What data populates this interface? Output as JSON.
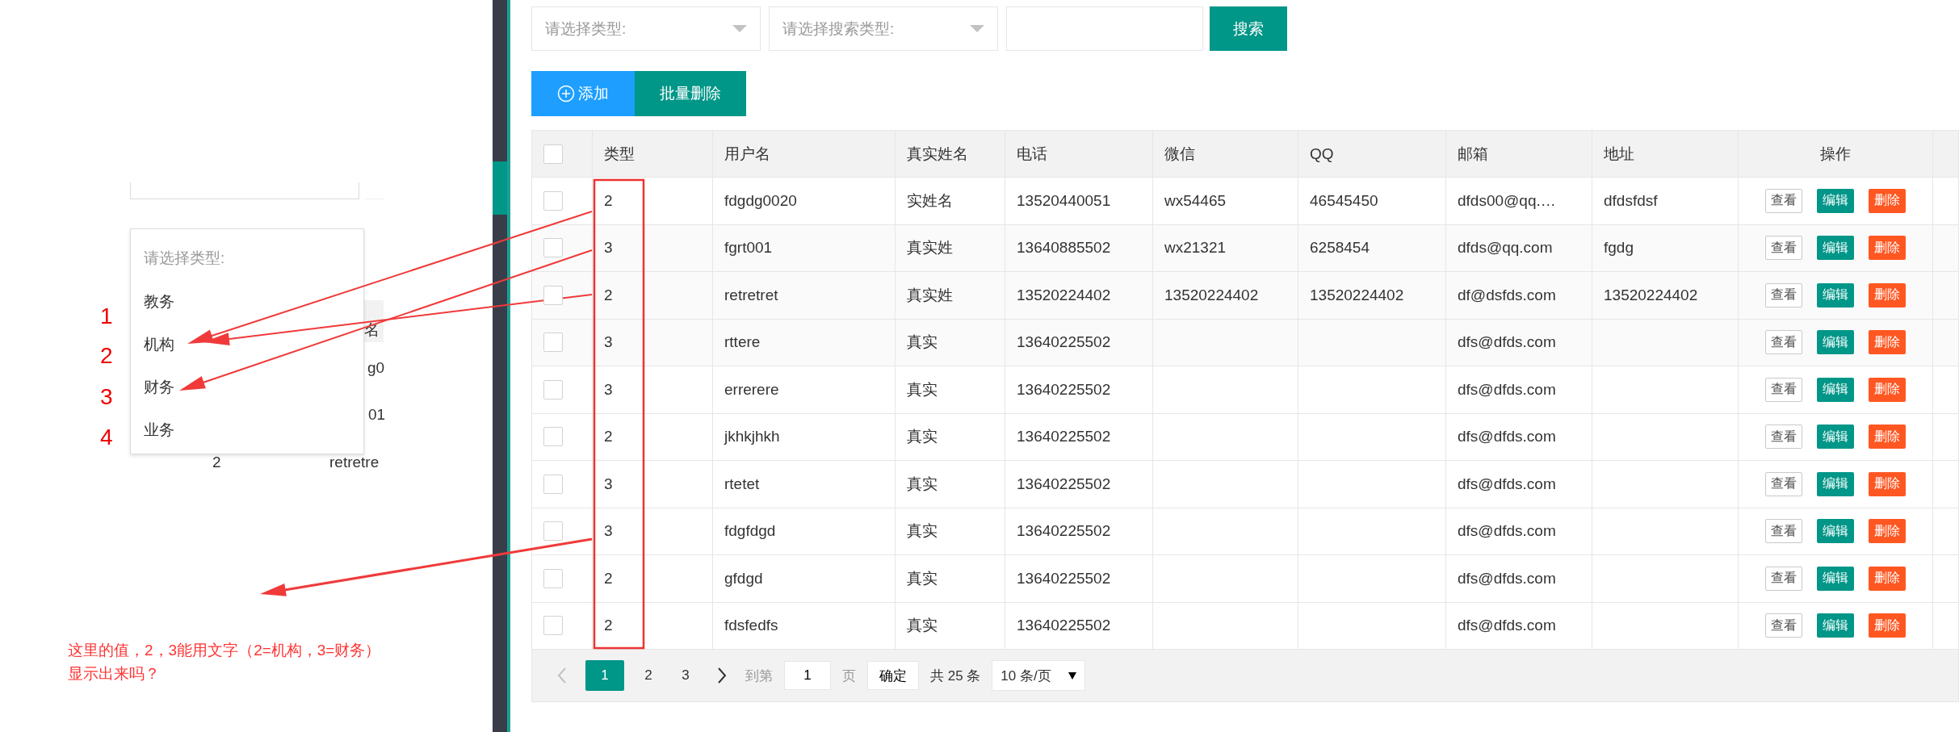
{
  "left_panel": {
    "table_fragment": {
      "texts": [
        "名",
        "g0",
        "01",
        "2",
        "retretre"
      ]
    },
    "dropdown": {
      "placeholder": "请选择类型:",
      "options": [
        {
          "label": "教务"
        },
        {
          "label": "机构"
        },
        {
          "label": "财务"
        },
        {
          "label": "业务"
        }
      ]
    }
  },
  "annotations": {
    "numbers": [
      "1",
      "2",
      "3",
      "4"
    ],
    "note": "这里的值，2，3能用文字（2=机构，3=财务）显示出来吗？"
  },
  "toolbar": {
    "type_select": {
      "placeholder": "请选择类型:"
    },
    "search_type_select": {
      "placeholder": "请选择搜索类型:"
    },
    "search_button": "搜索"
  },
  "actions": {
    "add_button": "添加",
    "batch_delete_button": "批量删除"
  },
  "table": {
    "header_checkbox": {
      "checked": false
    },
    "columns": [
      "类型",
      "用户名",
      "真实姓名",
      "电话",
      "微信",
      "QQ",
      "邮箱",
      "地址",
      "操作"
    ],
    "rows": [
      {
        "checked": false,
        "type": "2",
        "username": "fdgdg0020",
        "real_name": "实姓名",
        "phone": "13520440051",
        "wechat": "wx54465",
        "qq": "46545450",
        "email": "dfds00@qq.…",
        "address": "dfdsfdsf",
        "actions": [
          {
            "kind": "view",
            "label": "查看"
          },
          {
            "kind": "edit",
            "label": "编辑"
          },
          {
            "kind": "delete",
            "label": "删除"
          }
        ]
      },
      {
        "checked": false,
        "type": "3",
        "username": "fgrt001",
        "real_name": "真实姓",
        "phone": "13640885502",
        "wechat": "wx21321",
        "qq": "6258454",
        "email": "dfds@qq.com",
        "address": "fgdg",
        "actions": [
          {
            "kind": "view",
            "label": "查看"
          },
          {
            "kind": "edit",
            "label": "编辑"
          },
          {
            "kind": "delete",
            "label": "删除"
          }
        ]
      },
      {
        "checked": false,
        "type": "2",
        "username": "retretret",
        "real_name": "真实姓",
        "phone": "13520224402",
        "wechat": "13520224402",
        "qq": "13520224402",
        "email": "df@dsfds.com",
        "address": "13520224402",
        "actions": [
          {
            "kind": "view",
            "label": "查看"
          },
          {
            "kind": "edit",
            "label": "编辑"
          },
          {
            "kind": "delete",
            "label": "删除"
          }
        ]
      },
      {
        "checked": false,
        "type": "3",
        "username": "rttere",
        "real_name": "真实",
        "phone": "13640225502",
        "email": "dfs@dfds.com",
        "actions": [
          {
            "kind": "view",
            "label": "查看"
          },
          {
            "kind": "edit",
            "label": "编辑"
          },
          {
            "kind": "delete",
            "label": "删除"
          }
        ]
      },
      {
        "checked": false,
        "type": "3",
        "username": "errerere",
        "real_name": "真实",
        "phone": "13640225502",
        "email": "dfs@dfds.com",
        "actions": [
          {
            "kind": "view",
            "label": "查看"
          },
          {
            "kind": "edit",
            "label": "编辑"
          },
          {
            "kind": "delete",
            "label": "删除"
          }
        ]
      },
      {
        "checked": false,
        "type": "2",
        "username": "jkhkjhkh",
        "real_name": "真实",
        "phone": "13640225502",
        "email": "dfs@dfds.com",
        "actions": [
          {
            "kind": "view",
            "label": "查看"
          },
          {
            "kind": "edit",
            "label": "编辑"
          },
          {
            "kind": "delete",
            "label": "删除"
          }
        ]
      },
      {
        "checked": false,
        "type": "3",
        "username": "rtetet",
        "real_name": "真实",
        "phone": "13640225502",
        "email": "dfs@dfds.com",
        "actions": [
          {
            "kind": "view",
            "label": "查看"
          },
          {
            "kind": "edit",
            "label": "编辑"
          },
          {
            "kind": "delete",
            "label": "删除"
          }
        ]
      },
      {
        "checked": false,
        "type": "3",
        "username": "fdgfdgd",
        "real_name": "真实",
        "phone": "13640225502",
        "email": "dfs@dfds.com",
        "actions": [
          {
            "kind": "view",
            "label": "查看"
          },
          {
            "kind": "edit",
            "label": "编辑"
          },
          {
            "kind": "delete",
            "label": "删除"
          }
        ]
      },
      {
        "checked": false,
        "type": "2",
        "username": "gfdgd",
        "real_name": "真实",
        "phone": "13640225502",
        "email": "dfs@dfds.com",
        "actions": [
          {
            "kind": "view",
            "label": "查看"
          },
          {
            "kind": "edit",
            "label": "编辑"
          },
          {
            "kind": "delete",
            "label": "删除"
          }
        ]
      },
      {
        "checked": false,
        "type": "2",
        "username": "fdsfedfs",
        "real_name": "真实",
        "phone": "13640225502",
        "email": "dfs@dfds.com",
        "actions": [
          {
            "kind": "view",
            "label": "查看"
          },
          {
            "kind": "edit",
            "label": "编辑"
          },
          {
            "kind": "delete",
            "label": "删除"
          }
        ]
      }
    ]
  },
  "pagination": {
    "pages": [
      {
        "label": "1",
        "selected": true
      },
      {
        "label": "2",
        "selected": false
      },
      {
        "label": "3",
        "selected": false
      }
    ],
    "goto_label": "到第",
    "goto_value": "1",
    "page_unit": "页",
    "confirm_button": "确定",
    "total": "共 25 条",
    "page_size": "10 条/页"
  }
}
